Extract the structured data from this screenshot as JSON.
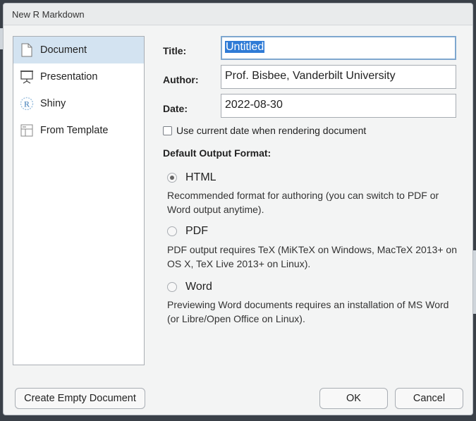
{
  "dialog": {
    "title": "New R Markdown"
  },
  "sidebar": {
    "items": [
      {
        "label": "Document",
        "icon": "document-icon",
        "selected": true
      },
      {
        "label": "Presentation",
        "icon": "presentation-icon",
        "selected": false
      },
      {
        "label": "Shiny",
        "icon": "shiny-icon",
        "selected": false
      },
      {
        "label": "From Template",
        "icon": "template-icon",
        "selected": false
      }
    ]
  },
  "form": {
    "title_label": "Title:",
    "title_value": "Untitled",
    "author_label": "Author:",
    "author_value": "Prof. Bisbee, Vanderbilt University",
    "date_label": "Date:",
    "date_value": "2022-08-30",
    "use_current_date_label": "Use current date when rendering document",
    "use_current_date_checked": false
  },
  "output_format": {
    "heading": "Default Output Format:",
    "options": [
      {
        "label": "HTML",
        "checked": true,
        "description": "Recommended format for authoring (you can switch to PDF or Word output anytime)."
      },
      {
        "label": "PDF",
        "checked": false,
        "description": "PDF output requires TeX (MiKTeX on Windows, MacTeX 2013+ on OS X, TeX Live 2013+ on Linux)."
      },
      {
        "label": "Word",
        "checked": false,
        "description": "Previewing Word documents requires an installation of MS Word (or Libre/Open Office on Linux)."
      }
    ]
  },
  "buttons": {
    "create_empty": "Create Empty Document",
    "ok": "OK",
    "cancel": "Cancel"
  },
  "colors": {
    "selection": "#d3e3f1",
    "text_highlight": "#2f7bd6",
    "focus_border": "#7ea7cf"
  }
}
